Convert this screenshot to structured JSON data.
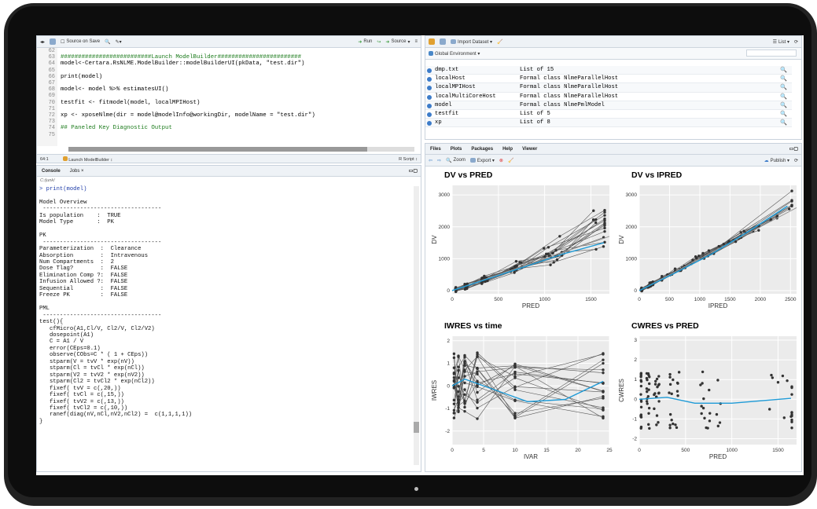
{
  "editor": {
    "toolbar": {
      "source_on_save": "Source on Save",
      "run": "Run",
      "source": "Source"
    },
    "line_numbers": [
      "62",
      "63",
      "64",
      "65",
      "66",
      "67",
      "68",
      "69",
      "70",
      "71",
      "72",
      "73",
      "74",
      "75"
    ],
    "lines": [
      "",
      "##########################Launch ModelBuilder########################",
      "model<-Certara.RsNLME.ModelBuilder::modelBuilderUI(pkData, \"test.dir\")",
      "",
      "print(model)",
      "",
      "model<- model %>% estimatesUI()",
      "",
      "testfit <- fitmodel(model, localMPIHost)",
      "",
      "xp <- xposeNlme(dir = model@modelInfo@workingDir, modelName = \"test.dir\")",
      "",
      "## Paneled Key Diagnostic Output",
      ""
    ],
    "status": {
      "position": "64:1",
      "scope": "Launch ModelBuilder ↕",
      "type": "R Script ↕"
    }
  },
  "console": {
    "tabs": [
      "Console",
      "Jobs ×"
    ],
    "path": "C:/junk/",
    "lines": [
      "> print(model)",
      "",
      "Model Overview",
      " -----------------------------------",
      "Is population    :  TRUE",
      "Model Type       :  PK",
      "",
      "PK",
      " -----------------------------------",
      "Parameterization  :  Clearance",
      "Absorption        :  Intravenous",
      "Num Compartments  :  2",
      "Dose Tlag?        :  FALSE",
      "Elimination Comp ?:  FALSE",
      "Infusion Allowed ?:  FALSE",
      "Sequential        :  FALSE",
      "Freeze PK         :  FALSE",
      "",
      "PML",
      " -----------------------------------",
      "test(){",
      "   cfMicro(A1,Cl/V, Cl2/V, Cl2/V2)",
      "   dosepoint(A1)",
      "   C = A1 / V",
      "   error(CEps=0.1)",
      "   observe(CObs=C * ( 1 + CEps))",
      "   stparm(V = tvV * exp(nV))",
      "   stparm(Cl = tvCl * exp(nCl))",
      "   stparm(V2 = tvV2 * exp(nV2))",
      "   stparm(Cl2 = tvCl2 * exp(nCl2))",
      "   fixef( tvV = c(,20,))",
      "   fixef( tvCl = c(,15,))",
      "   fixef( tvV2 = c(,13,))",
      "   fixef( tvCl2 = c(,10,))",
      "   ranef(diag(nV,nCl,nV2,nCl2) =  c(1,1,1,1))",
      "}"
    ]
  },
  "env": {
    "import_label": "Import Dataset ▾",
    "list_label": "List ▾",
    "scope": "Global Environment ▾",
    "rows": [
      {
        "name": "dmp.txt",
        "value": "List of 15"
      },
      {
        "name": "localHost",
        "value": "Formal class NlmeParallelHost"
      },
      {
        "name": "localMPIHost",
        "value": "Formal class NlmeParallelHost"
      },
      {
        "name": "localMultiCoreHost",
        "value": "Formal class NlmeParallelHost"
      },
      {
        "name": "model",
        "value": "Formal class NlmePmlModel"
      },
      {
        "name": "testfit",
        "value": "List of 5"
      },
      {
        "name": "xp",
        "value": "List of 8"
      }
    ]
  },
  "plots": {
    "tabs": [
      "Files",
      "Plots",
      "Packages",
      "Help",
      "Viewer"
    ],
    "zoom": "Zoom",
    "export": "Export ▾",
    "publish": "Publish ▾"
  },
  "chart_data": [
    {
      "type": "scatter",
      "title": "DV vs PRED",
      "xlabel": "PRED",
      "ylabel": "DV",
      "xlim": [
        0,
        1700
      ],
      "ylim": [
        -100,
        3300
      ],
      "xticks": [
        "0",
        "500",
        "1000",
        "1500"
      ],
      "yticks": [
        "0",
        "1000",
        "2000",
        "3000"
      ],
      "smooth_color": "#1f9bd7"
    },
    {
      "type": "scatter",
      "title": "DV vs IPRED",
      "xlabel": "IPRED",
      "ylabel": "DV",
      "xlim": [
        0,
        2600
      ],
      "ylim": [
        -100,
        3300
      ],
      "xticks": [
        "0",
        "500",
        "1000",
        "1500",
        "2000",
        "2500"
      ],
      "yticks": [
        "0",
        "1000",
        "2000",
        "3000"
      ],
      "smooth_color": "#1f9bd7"
    },
    {
      "type": "scatter",
      "title": "IWRES vs time",
      "xlabel": "IVAR",
      "ylabel": "IWRES",
      "xlim": [
        0,
        25
      ],
      "ylim": [
        -2.6,
        2.2
      ],
      "xticks": [
        "0",
        "5",
        "10",
        "15",
        "20",
        "25"
      ],
      "yticks": [
        "-2",
        "-1",
        "0",
        "1",
        "2"
      ],
      "smooth_color": "#1f9bd7"
    },
    {
      "type": "scatter",
      "title": "CWRES vs PRED",
      "xlabel": "PRED",
      "ylabel": "CWRES",
      "xlim": [
        0,
        1700
      ],
      "ylim": [
        -2.3,
        3.2
      ],
      "xticks": [
        "0",
        "500",
        "1000",
        "1500"
      ],
      "yticks": [
        "-2",
        "-1",
        "0",
        "1",
        "2",
        "3"
      ],
      "smooth_color": "#1f9bd7"
    }
  ]
}
